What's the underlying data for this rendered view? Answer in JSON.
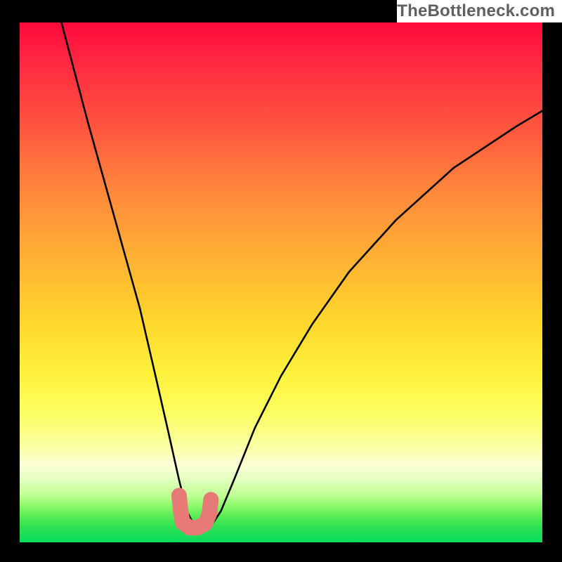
{
  "watermark": "TheBottleneck.com",
  "chart_data": {
    "type": "line",
    "title": "",
    "xlabel": "",
    "ylabel": "",
    "xlim": [
      0,
      100
    ],
    "ylim": [
      0,
      100
    ],
    "curve": {
      "description": "V-shaped bottleneck curve; steep descent from top-left to a flat minimum near x≈33, then a sweeping rise to the right",
      "x": [
        8,
        13,
        18,
        23,
        26,
        28.5,
        30.5,
        32,
        33.5,
        35,
        36.5,
        38.5,
        41,
        45,
        50,
        56,
        63,
        72,
        83,
        95,
        100
      ],
      "y": [
        100,
        81,
        63,
        45,
        32,
        21,
        12,
        6,
        3,
        2.5,
        3,
        6,
        12,
        22,
        32,
        42,
        52,
        62,
        72,
        80,
        83
      ]
    },
    "marker": {
      "description": "salmon U-shaped marker at the curve minimum",
      "color": "#e77a76",
      "points_x": [
        30.5,
        30.8,
        31.2,
        32.5,
        34,
        35.5,
        36.3,
        36.6
      ],
      "points_y": [
        9,
        6,
        3.8,
        2.8,
        2.8,
        3.6,
        5.5,
        8.2
      ]
    },
    "gradient_stops": [
      {
        "pct": 0,
        "color": "#ff0a3c"
      },
      {
        "pct": 7,
        "color": "#ff2641"
      },
      {
        "pct": 20,
        "color": "#ff5540"
      },
      {
        "pct": 33,
        "color": "#ff8a3b"
      },
      {
        "pct": 45,
        "color": "#ffb034"
      },
      {
        "pct": 57,
        "color": "#ffd52c"
      },
      {
        "pct": 67,
        "color": "#fff03a"
      },
      {
        "pct": 75,
        "color": "#fcff5f"
      },
      {
        "pct": 81,
        "color": "#fbff9d"
      },
      {
        "pct": 85,
        "color": "#fcffd6"
      },
      {
        "pct": 88,
        "color": "#e2ffbe"
      },
      {
        "pct": 91,
        "color": "#beff94"
      },
      {
        "pct": 93,
        "color": "#8cf96a"
      },
      {
        "pct": 95,
        "color": "#57ec53"
      },
      {
        "pct": 97,
        "color": "#2ee252"
      },
      {
        "pct": 100,
        "color": "#08db5c"
      }
    ]
  }
}
